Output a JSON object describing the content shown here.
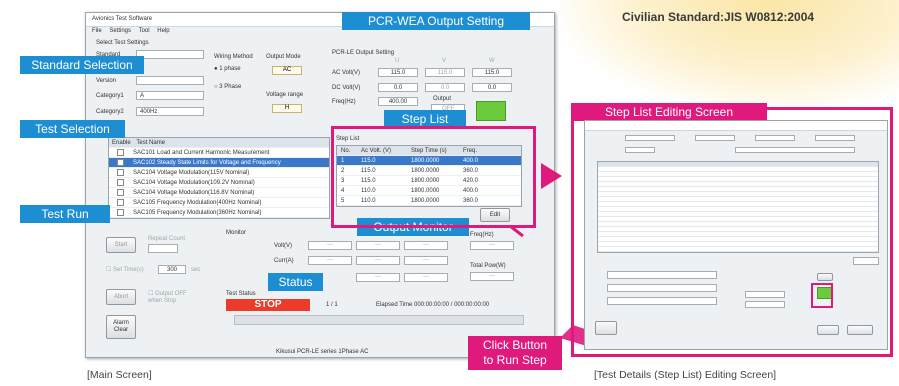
{
  "standard": "Civilian Standard:JIS W0812:2004",
  "main": {
    "title": "Avionics Test Software",
    "menu": [
      "File",
      "Settings",
      "Tool",
      "Help"
    ],
    "select_test_settings": "Select Test Settings",
    "standard_label": "Standard",
    "version_label": "Version",
    "category1_label": "Category1",
    "category1_value": "A",
    "category2_label": "Category2",
    "category2_value": "400Hz",
    "wiring_label": "Wiring Method",
    "wiring_options": [
      "1 phase",
      "3 Phase"
    ],
    "output_mode_label": "Output Mode",
    "output_mode_value": "AC",
    "voltage_range_label": "Voltage range",
    "voltage_range_value": "H",
    "pcr_header": "PCR-LE Output Setting",
    "phase_labels": [
      "U",
      "V",
      "W"
    ],
    "ac_label": "AC Volt(V)",
    "ac_values": [
      "115.0",
      "115.0",
      "115.0"
    ],
    "dc_label": "DC Volt(V)",
    "dc_values": [
      "0.0",
      "0.0",
      "0.0"
    ],
    "freq_label": "Freq(Hz)",
    "freq_value": "400.00",
    "output_label": "Output",
    "output_state": "OFF",
    "test_table": {
      "headers": [
        "Enable",
        "Test Name"
      ],
      "rows": [
        "SAC101  Load and Current Harmonic Measurement",
        "SAC102  Steady State Limits for Voltage and Frequency",
        "SAC104  Voltage Modulation(115V Nominal)",
        "SAC104  Voltage Modulation(109.2V Nominal)",
        "SAC104  Voltage Modulation(116.8V Nominal)",
        "SAC105  Frequency Modulation(400Hz Nominal)",
        "SAC105  Frequency Modulation(360Hz Nominal)"
      ],
      "selected_index": 1
    },
    "step_list": {
      "title": "Step List",
      "headers": [
        "No.",
        "Ac Volt. (V)",
        "Step Time (s)",
        "Freq."
      ],
      "rows": [
        [
          "1",
          "115.0",
          "1800.0000",
          "400.0"
        ],
        [
          "2",
          "115.0",
          "1800.0000",
          "360.0"
        ],
        [
          "3",
          "115.0",
          "1800.0000",
          "420.0"
        ],
        [
          "4",
          "110.0",
          "1800.0000",
          "400.0"
        ],
        [
          "5",
          "110.0",
          "1800.0000",
          "360.0"
        ]
      ],
      "selected_index": 0,
      "edit_label": "Edit"
    },
    "monitor_label": "Monitor",
    "monitor_rows": [
      "Volt(V)",
      "Curr(A)"
    ],
    "monitor_placeholder": "---",
    "freq_monitor_label": "Freq(Hz)",
    "total_power_label": "Total Pow(W)",
    "start_label": "Start",
    "repeat_label": "Repeat Count",
    "set_time_label": "Set Time(s)",
    "set_time_value": "300",
    "sec_label": "sec",
    "abort_label": "Abort",
    "output_off_label": "Output OFF when Stop",
    "alarm_label": "Alarm Clear",
    "test_status_label": "Test Status",
    "status_value": "STOP",
    "step_counter": "1 / 1",
    "elapsed_label": "Elapsed Time",
    "elapsed_value": "000:00:00:00",
    "total_time_value": "000:00:00:00",
    "status_bar": [
      "Kikusui PCR-LE series",
      "1Phase",
      "AC"
    ]
  },
  "callouts": {
    "pcr_output": "PCR-WEA Output Setting",
    "standard_selection": "Standard Selection",
    "test_selection": "Test Selection",
    "test_run": "Test Run",
    "step_list": "Step List",
    "output_monitor": "Output Monitor",
    "status": "Status",
    "step_editing": "Step List Editing Screen",
    "click_button_line1": "Click Button",
    "click_button_line2": "to Run Step"
  },
  "captions": {
    "main": "[Main Screen]",
    "details": "[Test Details (Step List) Editing Screen]"
  },
  "colors": {
    "callout_blue": "#1e8ed3",
    "highlight_magenta": "#e0197d",
    "stop_red": "#ec3b2a",
    "selection_blue": "#3a78c8",
    "output_green": "#6ccb3c"
  }
}
